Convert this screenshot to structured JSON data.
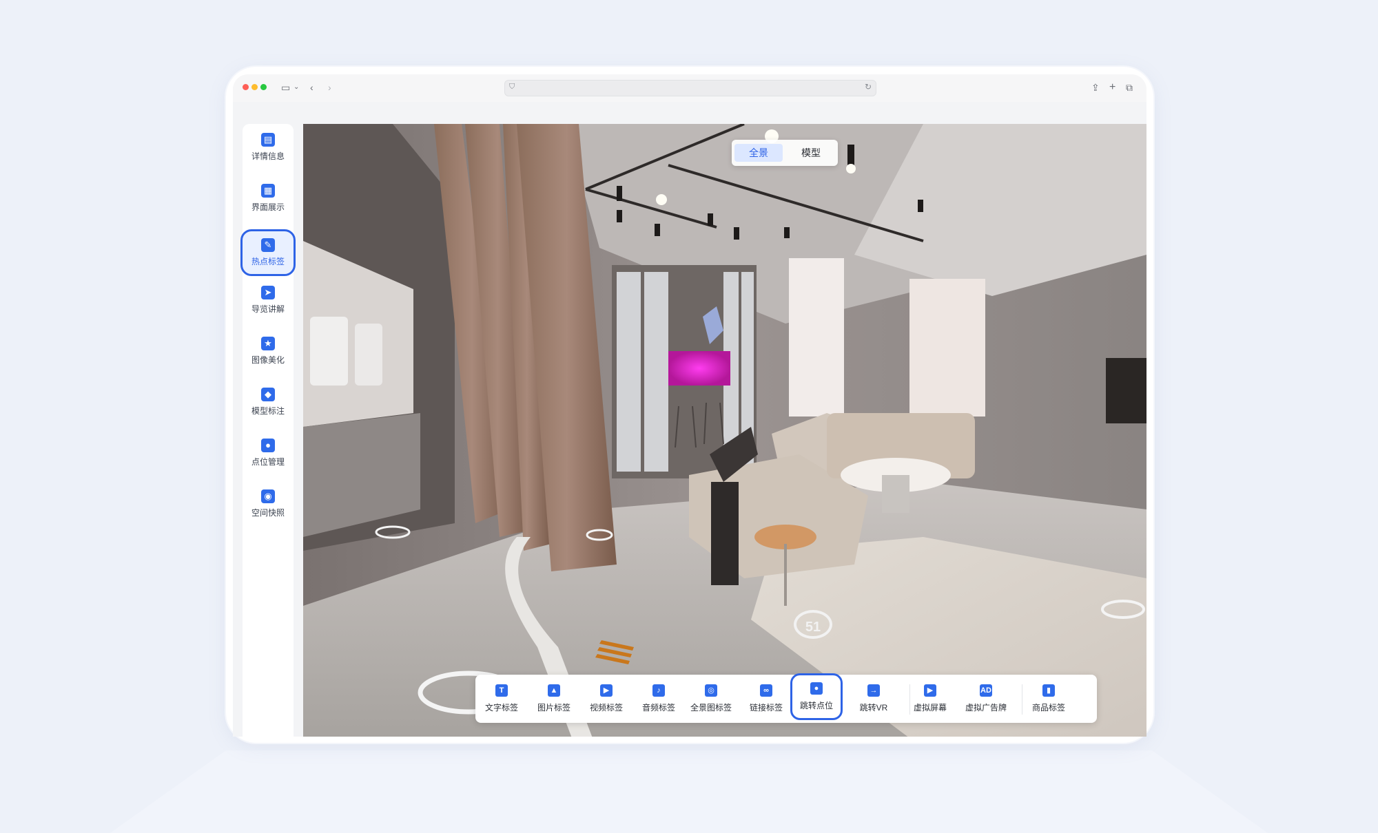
{
  "browser": {
    "url": ""
  },
  "sidebar": {
    "items": [
      {
        "label": "详情信息",
        "icon": "document-icon",
        "glyph": "▤"
      },
      {
        "label": "界面展示",
        "icon": "layout-icon",
        "glyph": "▦"
      },
      {
        "label": "热点标签",
        "icon": "pin-icon",
        "glyph": "✎"
      },
      {
        "label": "导览讲解",
        "icon": "send-icon",
        "glyph": "➤"
      },
      {
        "label": "图像美化",
        "icon": "image-star-icon",
        "glyph": "★"
      },
      {
        "label": "模型标注",
        "icon": "cube-icon",
        "glyph": "◆"
      },
      {
        "label": "点位管理",
        "icon": "location-icon",
        "glyph": "●"
      },
      {
        "label": "空间快照",
        "icon": "camera-icon",
        "glyph": "◉"
      }
    ],
    "active_index": 2
  },
  "viewer": {
    "modes": [
      "全景",
      "模型"
    ],
    "active_mode": "全景",
    "hotspot_marker": "51"
  },
  "toolbar": {
    "items": [
      {
        "label": "文字标签",
        "icon": "text-icon",
        "glyph": "T"
      },
      {
        "label": "图片标签",
        "icon": "image-icon",
        "glyph": "▲"
      },
      {
        "label": "视频标签",
        "icon": "video-icon",
        "glyph": "▶"
      },
      {
        "label": "音频标签",
        "icon": "audio-icon",
        "glyph": "♪"
      },
      {
        "label": "全景图标签",
        "icon": "panorama-icon",
        "glyph": "◎"
      },
      {
        "label": "链接标签",
        "icon": "link-icon",
        "glyph": "∞"
      },
      {
        "label": "跳转点位",
        "icon": "location-pin-icon",
        "glyph": "●"
      },
      {
        "label": "跳转VR",
        "icon": "jump-vr-icon",
        "glyph": "→"
      },
      {
        "label": "虚拟屏幕",
        "icon": "screen-icon",
        "glyph": "▶"
      },
      {
        "label": "虚拟广告牌",
        "icon": "ad-icon",
        "glyph": "AD"
      },
      {
        "label": "商品标签",
        "icon": "bag-icon",
        "glyph": "▮"
      }
    ],
    "active_index": 6
  },
  "colors": {
    "accent": "#2e63e6",
    "icon_blue": "#2f6bea"
  }
}
